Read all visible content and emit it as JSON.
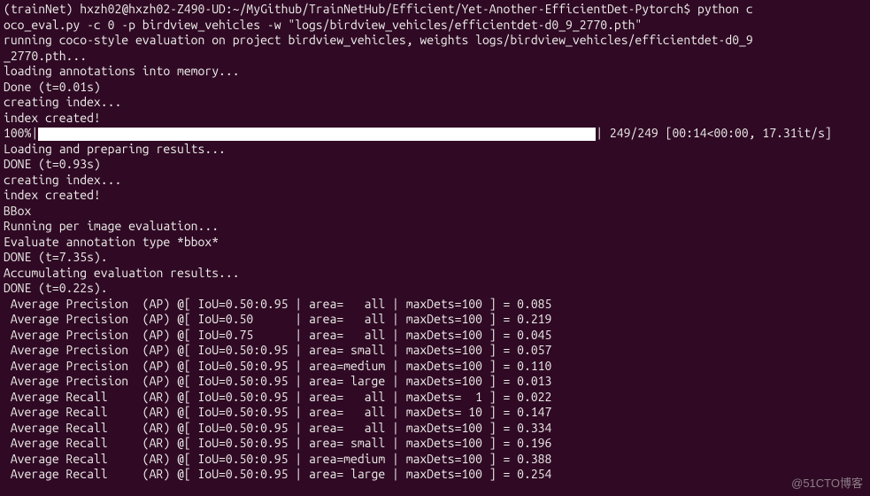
{
  "prompt": {
    "env": "(trainNet) ",
    "userhost": "hxzh02@hxzh02-Z490-UD",
    "path": ":~/MyGithub/TrainNetHub/Efficient/Yet-Another-EfficientDet-Pytorch$ ",
    "command_part1": "python c",
    "command_part2": "oco_eval.py -c 0 -p birdview_vehicles -w \"logs/birdview_vehicles/efficientdet-d0_9_2770.pth\""
  },
  "output": {
    "line1": "running coco-style evaluation on project birdview_vehicles, weights logs/birdview_vehicles/efficientdet-d0_9",
    "line2": "_2770.pth...",
    "line3": "loading annotations into memory...",
    "line4": "Done (t=0.01s)",
    "line5": "creating index...",
    "line6": "index created!",
    "progress_prefix": "100%|",
    "progress_suffix": "| 249/249 [00:14<00:00, 17.31it/s]",
    "line8": "Loading and preparing results...",
    "line9": "DONE (t=0.93s)",
    "line10": "creating index...",
    "line11": "index created!",
    "line12": "BBox",
    "line13": "Running per image evaluation...",
    "line14": "Evaluate annotation type *bbox*",
    "line15": "DONE (t=7.35s).",
    "line16": "Accumulating evaluation results...",
    "line17": "DONE (t=0.22s).",
    "ap1": " Average Precision  (AP) @[ IoU=0.50:0.95 | area=   all | maxDets=100 ] = 0.085",
    "ap2": " Average Precision  (AP) @[ IoU=0.50      | area=   all | maxDets=100 ] = 0.219",
    "ap3": " Average Precision  (AP) @[ IoU=0.75      | area=   all | maxDets=100 ] = 0.045",
    "ap4": " Average Precision  (AP) @[ IoU=0.50:0.95 | area= small | maxDets=100 ] = 0.057",
    "ap5": " Average Precision  (AP) @[ IoU=0.50:0.95 | area=medium | maxDets=100 ] = 0.110",
    "ap6": " Average Precision  (AP) @[ IoU=0.50:0.95 | area= large | maxDets=100 ] = 0.013",
    "ar1": " Average Recall     (AR) @[ IoU=0.50:0.95 | area=   all | maxDets=  1 ] = 0.022",
    "ar2": " Average Recall     (AR) @[ IoU=0.50:0.95 | area=   all | maxDets= 10 ] = 0.147",
    "ar3": " Average Recall     (AR) @[ IoU=0.50:0.95 | area=   all | maxDets=100 ] = 0.334",
    "ar4": " Average Recall     (AR) @[ IoU=0.50:0.95 | area= small | maxDets=100 ] = 0.196",
    "ar5": " Average Recall     (AR) @[ IoU=0.50:0.95 | area=medium | maxDets=100 ] = 0.388",
    "ar6": " Average Recall     (AR) @[ IoU=0.50:0.95 | area= large | maxDets=100 ] = 0.254"
  },
  "watermark": "@51CTO博客"
}
